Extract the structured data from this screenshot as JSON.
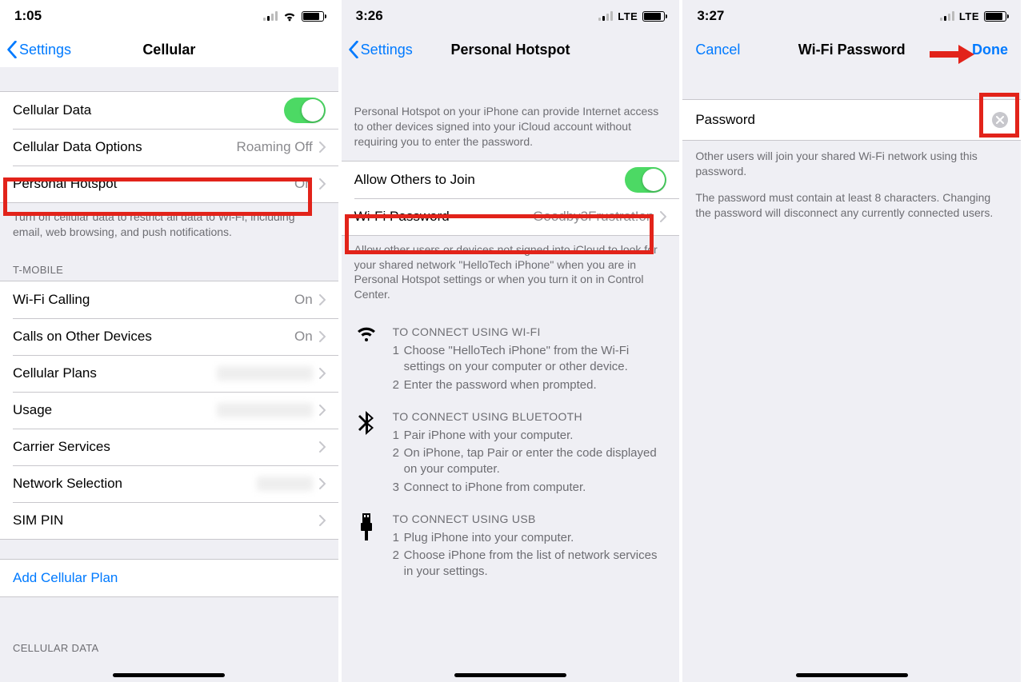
{
  "screen1": {
    "time": "1:05",
    "back": "Settings",
    "title": "Cellular",
    "cells": {
      "cellular_data": "Cellular Data",
      "cellular_data_options": "Cellular Data Options",
      "cellular_data_options_value": "Roaming Off",
      "personal_hotspot": "Personal Hotspot",
      "personal_hotspot_value": "On",
      "note1": "Turn off cellular data to restrict all data to Wi-Fi, including email, web browsing, and push notifications.",
      "carrier_header": "T-MOBILE",
      "wifi_calling": "Wi-Fi Calling",
      "wifi_calling_value": "On",
      "calls_other": "Calls on Other Devices",
      "calls_other_value": "On",
      "cellular_plans": "Cellular Plans",
      "usage": "Usage",
      "carrier_services": "Carrier Services",
      "network_selection": "Network Selection",
      "sim_pin": "SIM PIN",
      "add_plan": "Add Cellular Plan",
      "footer_header": "CELLULAR DATA"
    }
  },
  "screen2": {
    "time": "3:26",
    "lte": "LTE",
    "back": "Settings",
    "title": "Personal Hotspot",
    "note_top": "Personal Hotspot on your iPhone can provide Internet access to other devices signed into your iCloud account without requiring you to enter the password.",
    "allow_others": "Allow Others to Join",
    "wifi_password": "Wi-Fi Password",
    "wifi_password_value": "Goodby3Frustrat!on",
    "note_mid": "Allow other users or devices not signed into iCloud to look for your shared network \"HelloTech iPhone\" when you are in Personal Hotspot settings or when you turn it on in Control Center.",
    "wifi_title": "TO CONNECT USING WI-FI",
    "wifi_step1": "Choose \"HelloTech iPhone\" from the Wi-Fi settings on your computer or other device.",
    "wifi_step2": "Enter the password when prompted.",
    "bt_title": "TO CONNECT USING BLUETOOTH",
    "bt_step1": "Pair iPhone with your computer.",
    "bt_step2": "On iPhone, tap Pair or enter the code displayed on your computer.",
    "bt_step3": "Connect to iPhone from computer.",
    "usb_title": "TO CONNECT USING USB",
    "usb_step1": "Plug iPhone into your computer.",
    "usb_step2": "Choose iPhone from the list of network services in your settings."
  },
  "screen3": {
    "time": "3:27",
    "lte": "LTE",
    "cancel": "Cancel",
    "title": "Wi-Fi Password",
    "done": "Done",
    "password_label": "Password",
    "note1": "Other users will join your shared Wi-Fi network using this password.",
    "note2": "The password must contain at least 8 characters. Changing the password will disconnect any currently connected users."
  }
}
